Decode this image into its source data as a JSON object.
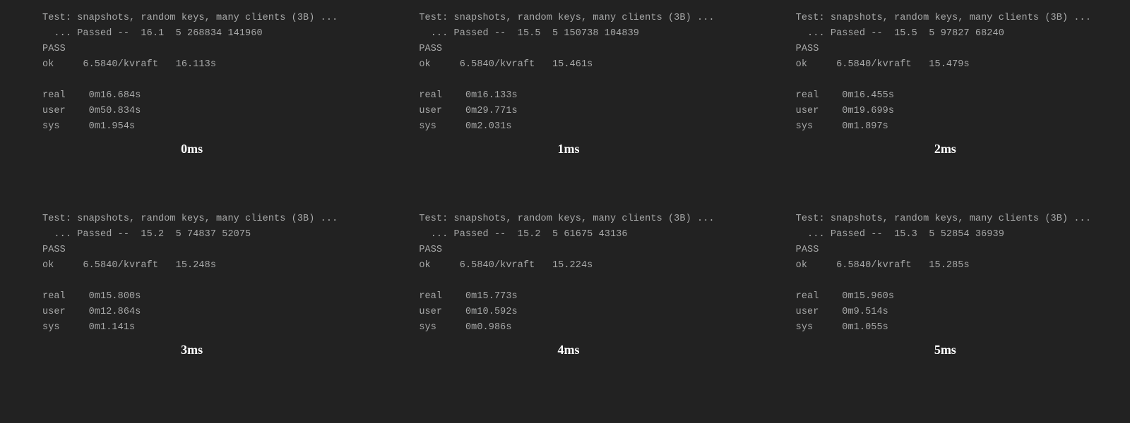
{
  "panels": [
    {
      "caption": "0ms",
      "lines": {
        "test": "Test: snapshots, random keys, many clients (3B) ...",
        "passed": "  ... Passed --  16.1  5 268834 141960",
        "pass": "PASS",
        "ok": "ok     6.5840/kvraft   16.113s",
        "blank": "",
        "real": "real    0m16.684s",
        "user": "user    0m50.834s",
        "sys": "sys     0m1.954s"
      }
    },
    {
      "caption": "1ms",
      "lines": {
        "test": "Test: snapshots, random keys, many clients (3B) ...",
        "passed": "  ... Passed --  15.5  5 150738 104839",
        "pass": "PASS",
        "ok": "ok     6.5840/kvraft   15.461s",
        "blank": "",
        "real": "real    0m16.133s",
        "user": "user    0m29.771s",
        "sys": "sys     0m2.031s"
      }
    },
    {
      "caption": "2ms",
      "lines": {
        "test": "Test: snapshots, random keys, many clients (3B) ...",
        "passed": "  ... Passed --  15.5  5 97827 68240",
        "pass": "PASS",
        "ok": "ok     6.5840/kvraft   15.479s",
        "blank": "",
        "real": "real    0m16.455s",
        "user": "user    0m19.699s",
        "sys": "sys     0m1.897s"
      }
    },
    {
      "caption": "3ms",
      "lines": {
        "test": "Test: snapshots, random keys, many clients (3B) ...",
        "passed": "  ... Passed --  15.2  5 74837 52075",
        "pass": "PASS",
        "ok": "ok     6.5840/kvraft   15.248s",
        "blank": "",
        "real": "real    0m15.800s",
        "user": "user    0m12.864s",
        "sys": "sys     0m1.141s"
      }
    },
    {
      "caption": "4ms",
      "lines": {
        "test": "Test: snapshots, random keys, many clients (3B) ...",
        "passed": "  ... Passed --  15.2  5 61675 43136",
        "pass": "PASS",
        "ok": "ok     6.5840/kvraft   15.224s",
        "blank": "",
        "real": "real    0m15.773s",
        "user": "user    0m10.592s",
        "sys": "sys     0m0.986s"
      }
    },
    {
      "caption": "5ms",
      "lines": {
        "test": "Test: snapshots, random keys, many clients (3B) ...",
        "passed": "  ... Passed --  15.3  5 52854 36939",
        "pass": "PASS",
        "ok": "ok     6.5840/kvraft   15.285s",
        "blank": "",
        "real": "real    0m15.960s",
        "user": "user    0m9.514s",
        "sys": "sys     0m1.055s"
      }
    }
  ]
}
